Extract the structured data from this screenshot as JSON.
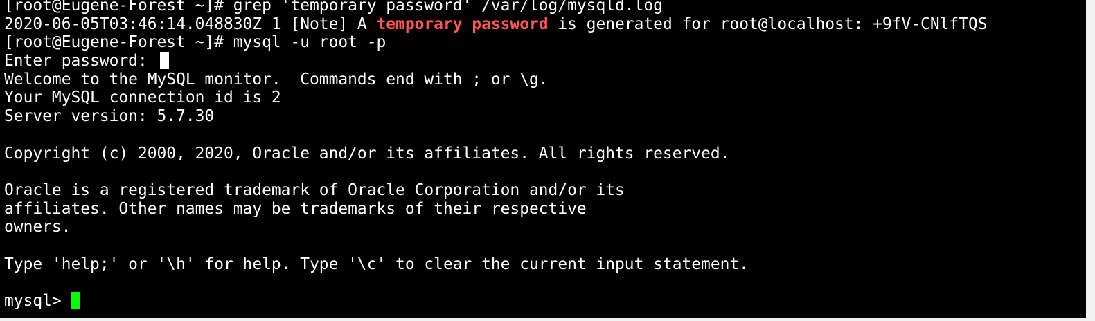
{
  "terminal": {
    "lines": [
      "[root@Eugene-Forest ~]# grep 'temporary password' /var/log/mysqld.log",
      {
        "pre": "2020-06-05T03:46:14.048830Z 1 [Note] A ",
        "highlight": "temporary password",
        "post": " is generated for root@localhost: +9fV-CNlfTQS"
      },
      "[root@Eugene-Forest ~]# mysql -u root -p",
      "Enter password: ",
      "Welcome to the MySQL monitor.  Commands end with ; or \\g.",
      "Your MySQL connection id is 2",
      "Server version: 5.7.30",
      "",
      "Copyright (c) 2000, 2020, Oracle and/or its affiliates. All rights reserved.",
      "",
      "Oracle is a registered trademark of Oracle Corporation and/or its",
      "affiliates. Other names may be trademarks of their respective",
      "owners.",
      "",
      "Type 'help;' or '\\h' for help. Type '\\c' to clear the current input statement.",
      "",
      "mysql> "
    ]
  },
  "colors": {
    "background": "#000000",
    "foreground": "#ffffff",
    "highlight": "#ff5555",
    "cursor": "#00ff00"
  }
}
